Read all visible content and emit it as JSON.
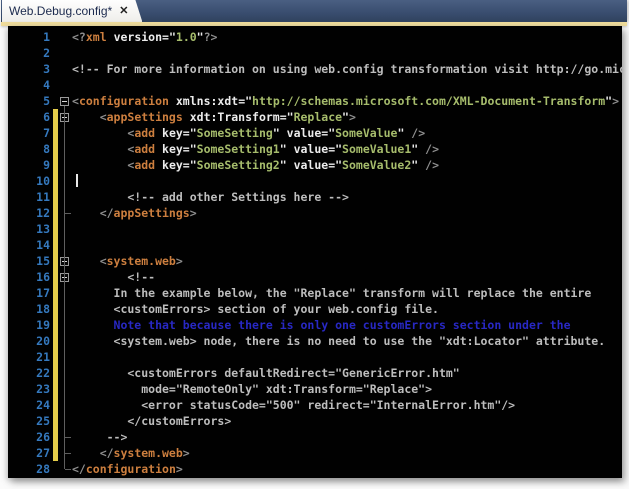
{
  "tab": {
    "title": "Web.Debug.config*",
    "close_icon": "✕"
  },
  "colors": {
    "tab_strip": "#3a4e70",
    "tab_background": "#f4f3ef",
    "gold_divider": "#efdc9b",
    "editor_background": "#010101",
    "line_number": "#3579be",
    "change_bar": "#e6ce4a",
    "element_name": "#cd7f3f",
    "attribute_name": "#ececec",
    "attribute_value": "#a6bc6c",
    "delimiter": "#8f8f8f",
    "comment": "#bdbdbd",
    "note_blue": "#2828c4"
  },
  "editor": {
    "cursor_line": 10,
    "fold_boxes": [
      5,
      6,
      15,
      16
    ],
    "fold_ticks": [
      12,
      26,
      27,
      28
    ],
    "change_bar": {
      "from": 6,
      "to": 27
    },
    "lines": [
      {
        "n": 1,
        "tokens": [
          [
            "d",
            "<?"
          ],
          [
            "e",
            "xml"
          ],
          [
            "a",
            " version=\""
          ],
          [
            "v",
            "1.0"
          ],
          [
            "a",
            "\""
          ],
          [
            "d",
            "?>"
          ]
        ]
      },
      {
        "n": 2,
        "tokens": []
      },
      {
        "n": 3,
        "tokens": [
          [
            "c",
            "<!-- For more information on using web.config transformation visit http://go.mic"
          ]
        ]
      },
      {
        "n": 4,
        "tokens": []
      },
      {
        "n": 5,
        "tokens": [
          [
            "d",
            "<"
          ],
          [
            "e",
            "configuration"
          ],
          [
            "a",
            " xmlns:xdt=\""
          ],
          [
            "v",
            "http://schemas.microsoft.com/XML-Document-Transform"
          ],
          [
            "a",
            "\""
          ],
          [
            "d",
            ">"
          ]
        ]
      },
      {
        "n": 6,
        "tokens": [
          [
            "d",
            "    <"
          ],
          [
            "e",
            "appSettings"
          ],
          [
            "a",
            " xdt:Transform=\""
          ],
          [
            "v",
            "Replace"
          ],
          [
            "a",
            "\""
          ],
          [
            "d",
            ">"
          ]
        ]
      },
      {
        "n": 7,
        "tokens": [
          [
            "d",
            "        <"
          ],
          [
            "e",
            "add"
          ],
          [
            "a",
            " key=\""
          ],
          [
            "v",
            "SomeSetting"
          ],
          [
            "a",
            "\" value=\""
          ],
          [
            "v",
            "SomeValue"
          ],
          [
            "a",
            "\""
          ],
          [
            "d",
            " />"
          ]
        ]
      },
      {
        "n": 8,
        "tokens": [
          [
            "d",
            "        <"
          ],
          [
            "e",
            "add"
          ],
          [
            "a",
            " key=\""
          ],
          [
            "v",
            "SomeSetting1"
          ],
          [
            "a",
            "\" value=\""
          ],
          [
            "v",
            "SomeValue1"
          ],
          [
            "a",
            "\""
          ],
          [
            "d",
            " />"
          ]
        ]
      },
      {
        "n": 9,
        "tokens": [
          [
            "d",
            "        <"
          ],
          [
            "e",
            "add"
          ],
          [
            "a",
            " key=\""
          ],
          [
            "v",
            "SomeSetting2"
          ],
          [
            "a",
            "\" value=\""
          ],
          [
            "v",
            "SomeValue2"
          ],
          [
            "a",
            "\""
          ],
          [
            "d",
            " />"
          ]
        ]
      },
      {
        "n": 10,
        "tokens": []
      },
      {
        "n": 11,
        "tokens": [
          [
            "c",
            "        <!-- add other Settings here -->"
          ]
        ]
      },
      {
        "n": 12,
        "tokens": [
          [
            "d",
            "    </"
          ],
          [
            "e",
            "appSettings"
          ],
          [
            "d",
            ">"
          ]
        ]
      },
      {
        "n": 13,
        "tokens": []
      },
      {
        "n": 14,
        "tokens": []
      },
      {
        "n": 15,
        "tokens": [
          [
            "d",
            "    <"
          ],
          [
            "e",
            "system.web"
          ],
          [
            "d",
            ">"
          ]
        ]
      },
      {
        "n": 16,
        "tokens": [
          [
            "c",
            "        <!--"
          ]
        ]
      },
      {
        "n": 17,
        "tokens": [
          [
            "c",
            "      In the example below, the \"Replace\" transform will replace the entire"
          ]
        ]
      },
      {
        "n": 18,
        "tokens": [
          [
            "c",
            "      <customErrors> section of your web.config file."
          ]
        ]
      },
      {
        "n": 19,
        "tokens": [
          [
            "b",
            "      Note that because there is only one customErrors section under the"
          ]
        ]
      },
      {
        "n": 20,
        "tokens": [
          [
            "c",
            "      <system.web> node, there is no need to use the \"xdt:Locator\" attribute."
          ]
        ]
      },
      {
        "n": 21,
        "tokens": []
      },
      {
        "n": 22,
        "tokens": [
          [
            "c",
            "        <customErrors defaultRedirect=\"GenericError.htm\""
          ]
        ]
      },
      {
        "n": 23,
        "tokens": [
          [
            "c",
            "          mode=\"RemoteOnly\" xdt:Transform=\"Replace\">"
          ]
        ]
      },
      {
        "n": 24,
        "tokens": [
          [
            "c",
            "          <error statusCode=\"500\" redirect=\"InternalError.htm\"/>"
          ]
        ]
      },
      {
        "n": 25,
        "tokens": [
          [
            "c",
            "        </customErrors>"
          ]
        ]
      },
      {
        "n": 26,
        "tokens": [
          [
            "c",
            "     -->"
          ]
        ]
      },
      {
        "n": 27,
        "tokens": [
          [
            "d",
            "    </"
          ],
          [
            "e",
            "system.web"
          ],
          [
            "d",
            ">"
          ]
        ]
      },
      {
        "n": 28,
        "tokens": [
          [
            "d",
            "</"
          ],
          [
            "e",
            "configuration"
          ],
          [
            "d",
            ">"
          ]
        ]
      }
    ]
  }
}
